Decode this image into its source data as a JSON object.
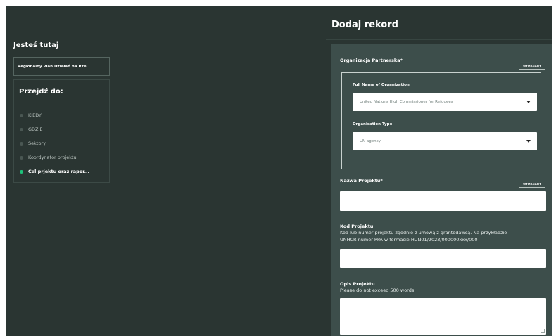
{
  "left": {
    "here_title": "Jesteś tutaj",
    "breadcrumb": "Regionalny Plan Działań na Rze...",
    "nav_title": "Przejdź do:",
    "nav_items": [
      {
        "label": "KIEDY",
        "active": false
      },
      {
        "label": "GDZIE",
        "active": false
      },
      {
        "label": "Sektory",
        "active": false
      },
      {
        "label": "Koordynator projektu",
        "active": false
      },
      {
        "label": "Cel prjektu oraz rapor...",
        "active": true
      }
    ]
  },
  "form": {
    "title": "Dodaj rekord",
    "required_badge": "WYMAGANY",
    "partner_org": {
      "label": "Organizacja Partnerska*",
      "full_name_label": "Full Name of Organization",
      "full_name_value": "United Nations High Commissioner for Refugees",
      "type_label": "Organisation Type",
      "type_value": "UN agency"
    },
    "project_name": {
      "label": "Nazwa Projektu*",
      "value": ""
    },
    "project_code": {
      "label": "Kod Projektu",
      "desc_line1": "Kod lub numer projektu zgodnie z umową z grantodawcą. Na przykładzie",
      "desc_line2": "UNHCR numer PPA w formacie HUN01/2023/000000xxx/000",
      "value": ""
    },
    "project_desc": {
      "label": "Opis Projektu",
      "desc": "Please do not exceed 500 words",
      "value": ""
    }
  },
  "colors": {
    "background": "#2a3532",
    "panel": "#3d4e4b",
    "active_dot": "#1ec27a"
  }
}
